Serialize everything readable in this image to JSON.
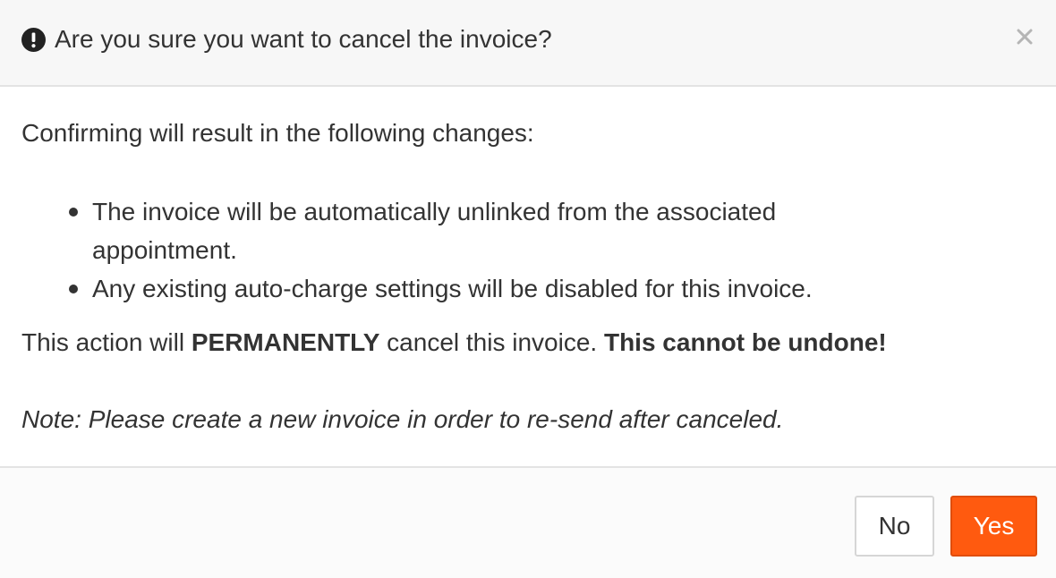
{
  "dialog": {
    "title": "Are you sure you want to cancel the invoice?",
    "header_icon": "exclamation-circle-icon",
    "close_icon": "close-icon",
    "close_glyph": "×"
  },
  "body": {
    "intro": "Confirming will result in the following changes:",
    "changes": [
      "The invoice will be automatically unlinked from the associated appointment.",
      "Any existing auto-charge settings will be disabled for this invoice."
    ],
    "warning_prefix": "This action will ",
    "warning_emphasis": "PERMANENTLY",
    "warning_middle": " cancel this invoice. ",
    "warning_strong": "This cannot be undone!",
    "note": "Note: Please create a new invoice in order to re-send after canceled."
  },
  "footer": {
    "no_label": "No",
    "yes_label": "Yes"
  },
  "colors": {
    "accent": "#ff5a0f",
    "text": "#333333",
    "header_bg": "#f7f7f7"
  }
}
